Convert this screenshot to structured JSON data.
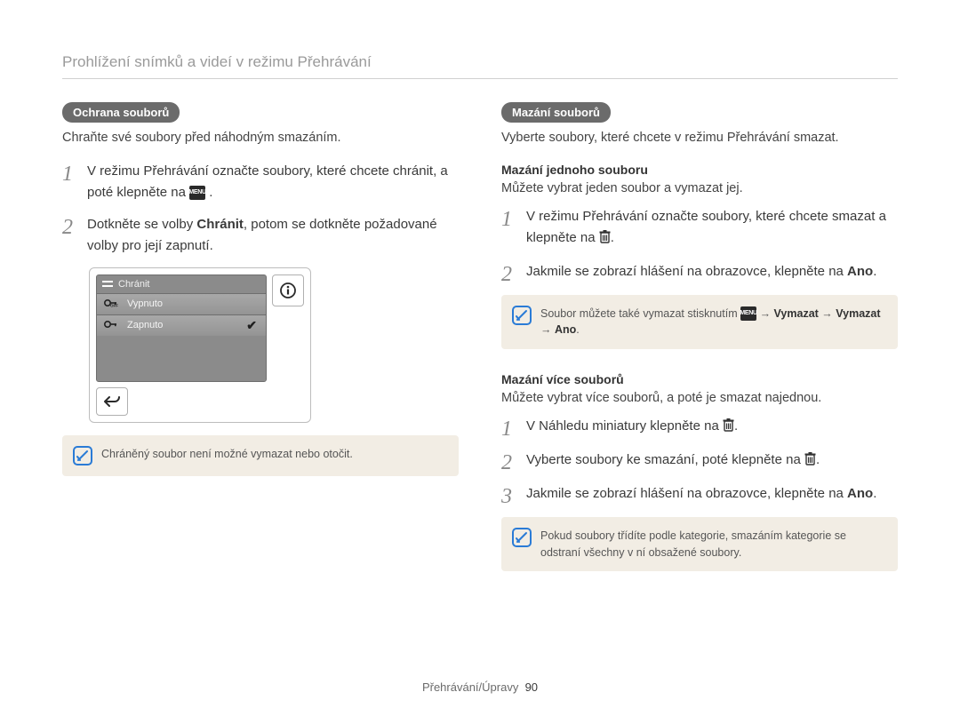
{
  "page_title": "Prohlížení snímků a videí v režimu Přehrávání",
  "left": {
    "pill": "Ochrana souborů",
    "lead": "Chraňte své soubory před náhodným smazáním.",
    "steps": {
      "s1a": "V režimu Přehrávání označte soubory, které chcete chránit, a poté klepněte na ",
      "s1b": " .",
      "menu_icon": "MENU",
      "s2a": "Dotkněte se volby ",
      "s2b": "Chránit",
      "s2c": ", potom se dotkněte požadované volby pro její zapnutí."
    },
    "ui": {
      "title": "Chránit",
      "off_label": "Vypnuto",
      "off_prefix": "OFF",
      "on_label": "Zapnuto"
    },
    "note": "Chráněný soubor není možné vymazat nebo otočit."
  },
  "right": {
    "pill": "Mazání souborů",
    "lead": "Vyberte soubory, které chcete v režimu Přehrávání smazat.",
    "one": {
      "h": "Mazání jednoho souboru",
      "p": "Můžete vybrat jeden soubor a vymazat jej.",
      "s1a": "V režimu Přehrávání označte soubory, které chcete smazat a klepněte na ",
      "s1b": ".",
      "s2a": "Jakmile se zobrazí hlášení na obrazovce, klepněte na ",
      "s2b": "Ano",
      "s2c": ".",
      "note_a": "Soubor můžete také vymazat stisknutím ",
      "note_b": " → ",
      "note_c": "Vymazat",
      "note_d": " → ",
      "note_e": "Vymazat",
      "note_f": " → ",
      "note_g": "Ano",
      "note_h": ".",
      "menu_icon": "MENU"
    },
    "many": {
      "h": "Mazání více souborů",
      "p": "Můžete vybrat více souborů, a poté je smazat najednou.",
      "s1a": "V Náhledu miniatury klepněte na ",
      "s1b": ".",
      "s2a": "Vyberte soubory ke smazání, poté klepněte na ",
      "s2b": ".",
      "s3a": "Jakmile se zobrazí hlášení na obrazovce, klepněte na ",
      "s3b": "Ano",
      "s3c": ".",
      "note": "Pokud soubory třídíte podle kategorie, smazáním kategorie se odstraní všechny v ní obsažené soubory."
    }
  },
  "footer": {
    "section": "Přehrávání/Úpravy",
    "page": "90"
  }
}
